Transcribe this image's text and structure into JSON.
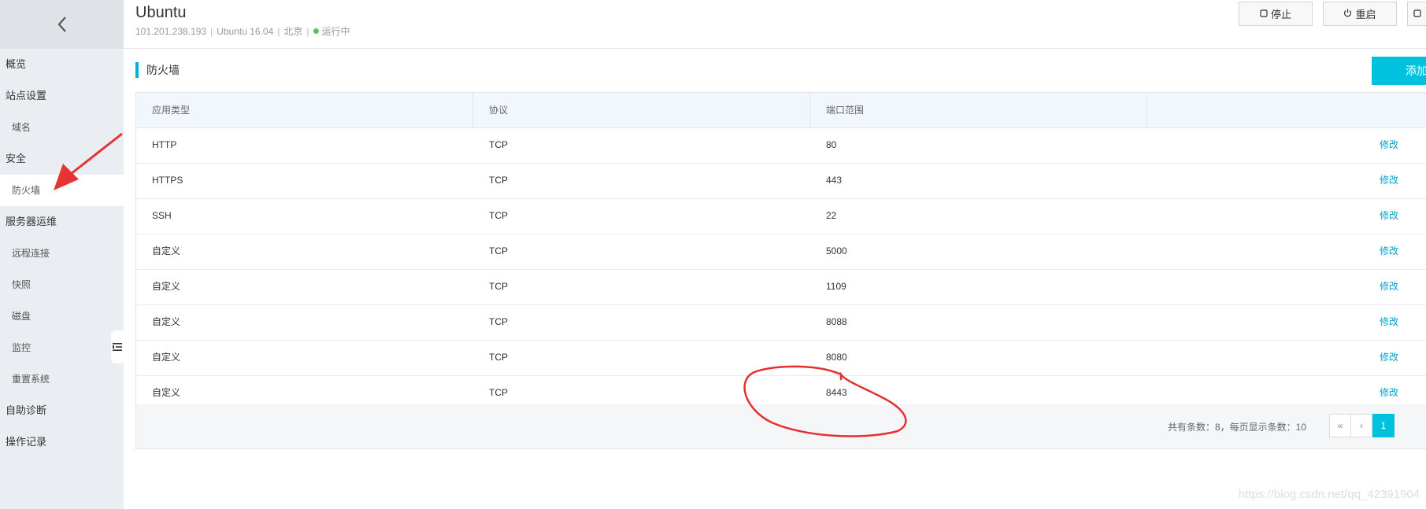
{
  "sidebar": {
    "items": [
      {
        "label": "概览",
        "level": "top"
      },
      {
        "label": "站点设置",
        "level": "top"
      },
      {
        "label": "域名",
        "level": "sub"
      },
      {
        "label": "安全",
        "level": "top"
      },
      {
        "label": "防火墙",
        "level": "sub",
        "active": true
      },
      {
        "label": "服务器运维",
        "level": "top"
      },
      {
        "label": "远程连接",
        "level": "sub"
      },
      {
        "label": "快照",
        "level": "sub"
      },
      {
        "label": "磁盘",
        "level": "sub"
      },
      {
        "label": "监控",
        "level": "sub"
      },
      {
        "label": "重置系统",
        "level": "sub"
      },
      {
        "label": "自助诊断",
        "level": "top"
      },
      {
        "label": "操作记录",
        "level": "top"
      }
    ]
  },
  "header": {
    "title": "Ubuntu",
    "ip": "101.201.238.193",
    "os": "Ubuntu 16.04",
    "region": "北京",
    "status": "运行中",
    "status_color": "#5ac26a",
    "stop_label": "停止",
    "restart_label": "重启"
  },
  "section": {
    "title": "防火墙",
    "add_label": "添加",
    "accent": "#00c1de"
  },
  "table": {
    "headers": [
      "应用类型",
      "协议",
      "端口范围",
      ""
    ],
    "op_label": "修改",
    "rows": [
      {
        "type": "HTTP",
        "protocol": "TCP",
        "port": "80"
      },
      {
        "type": "HTTPS",
        "protocol": "TCP",
        "port": "443"
      },
      {
        "type": "SSH",
        "protocol": "TCP",
        "port": "22"
      },
      {
        "type": "自定义",
        "protocol": "TCP",
        "port": "5000"
      },
      {
        "type": "自定义",
        "protocol": "TCP",
        "port": "1109"
      },
      {
        "type": "自定义",
        "protocol": "TCP",
        "port": "8088"
      },
      {
        "type": "自定义",
        "protocol": "TCP",
        "port": "8080"
      },
      {
        "type": "自定义",
        "protocol": "TCP",
        "port": "8443"
      }
    ]
  },
  "pager": {
    "info": "共有条数：8，每页显示条数：10",
    "first": "«",
    "prev": "‹",
    "current": "1"
  },
  "watermark": "https://blog.csdn.net/qq_42391904"
}
